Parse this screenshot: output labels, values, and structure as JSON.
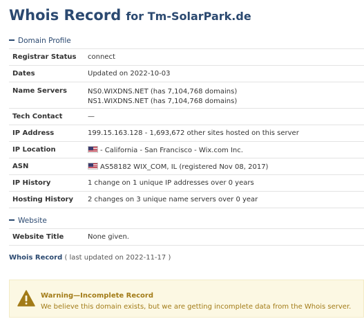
{
  "title": {
    "main": "Whois Record",
    "sub": "for Tm-SolarPark.de"
  },
  "domain_profile": {
    "heading": "Domain Profile",
    "rows": [
      {
        "key": "Registrar Status",
        "lines": [
          "connect"
        ]
      },
      {
        "key": "Dates",
        "lines": [
          "Updated on 2022-10-03"
        ]
      },
      {
        "key": "Name Servers",
        "lines": [
          "NS0.WIXDNS.NET (has 7,104,768 domains)",
          "NS1.WIXDNS.NET (has 7,104,768 domains)"
        ]
      },
      {
        "key": "Tech Contact",
        "lines": [
          "—"
        ]
      },
      {
        "key": "IP Address",
        "lines": [
          "199.15.163.128 - 1,693,672 other sites hosted on this server"
        ]
      },
      {
        "key": "IP Location",
        "flag": "us-flag-icon",
        "lines": [
          "- California - San Francisco - Wix.com Inc."
        ]
      },
      {
        "key": "ASN",
        "flag": "us-flag-icon",
        "lines": [
          "AS58182 WIX_COM, IL (registered Nov 08, 2017)"
        ]
      },
      {
        "key": "IP History",
        "lines": [
          "1 change on 1 unique IP addresses over 0 years"
        ]
      },
      {
        "key": "Hosting History",
        "lines": [
          "2 changes on 3 unique name servers over 0 year"
        ]
      }
    ]
  },
  "website": {
    "heading": "Website",
    "rows": [
      {
        "key": "Website Title",
        "lines": [
          "None given."
        ]
      }
    ]
  },
  "whois_record": {
    "link": "Whois Record",
    "note": "( last updated on 2022-11-17 )"
  },
  "warning": {
    "icon": "warning-triangle-icon",
    "title": "Warning—Incomplete Record",
    "text": "We believe this domain exists, but we are getting incomplete data from the Whois server."
  },
  "colors": {
    "heading": "#2b4970",
    "warning_bg": "#fcf8e3",
    "warning_text": "#a27b17",
    "warning_icon": "#a27b17"
  }
}
